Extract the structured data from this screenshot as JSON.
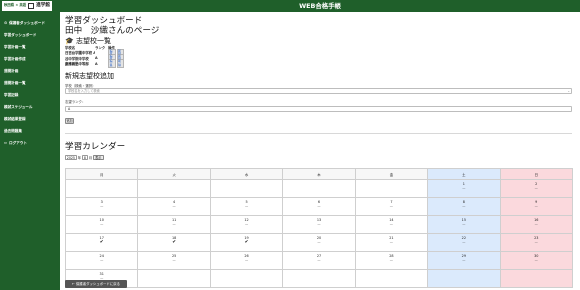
{
  "header": {
    "brand_line1": "WEB合格手帳",
    "brand_line2": "秋田県 × 英語",
    "brand_line3": "進学館",
    "title": "WEB合格手帳"
  },
  "sidebar": {
    "items": [
      {
        "icon": "⚙",
        "label": "保護者ダッシュボード"
      },
      {
        "icon": "",
        "label": "学習ダッシュボード"
      },
      {
        "icon": "",
        "label": "学習計画一覧"
      },
      {
        "icon": "",
        "label": "学習計画作成"
      },
      {
        "icon": "",
        "label": "週間計画"
      },
      {
        "icon": "",
        "label": "週間計画一覧"
      },
      {
        "icon": "",
        "label": "学習記録"
      },
      {
        "icon": "",
        "label": "模試スケジュール"
      },
      {
        "icon": "",
        "label": "模試結果登録"
      },
      {
        "icon": "",
        "label": "過去問題集"
      },
      {
        "icon": "⇦",
        "label": "ログアウト"
      }
    ]
  },
  "main": {
    "page_title": "学習ダッシュボード",
    "user_heading": "田中　沙織さんのページ",
    "school_section_icon": "🎓",
    "school_section_title": "志望校一覧",
    "school_table": {
      "headers": [
        "学校名",
        "ランク",
        "操作"
      ],
      "rows": [
        {
          "name": "日吉台学園中学校 A",
          "rank": "",
          "edit": "編集",
          "delete": "削除"
        },
        {
          "name": "谷中学院中学校",
          "rank": "A",
          "edit": "編集",
          "delete": "削除"
        },
        {
          "name": "慶應義塾中等部",
          "rank": "A",
          "edit": "編集",
          "delete": "削除"
        }
      ]
    },
    "new_school_title": "新規志望校追加",
    "school_field_label": "学校（検索・選択）",
    "school_field_placeholder": "学校名を入力して検索",
    "rank_field_label": "志望ランク：",
    "rank_field_value": "A",
    "add_button": "追加",
    "calendar_title": "学習カレンダー",
    "calendar_controls": {
      "year": "2025",
      "year_suffix": "年",
      "month": "8",
      "month_suffix": "月",
      "show_button": "表示"
    },
    "weekdays": [
      "月",
      "火",
      "水",
      "木",
      "金",
      "土",
      "日"
    ],
    "weeks": [
      [
        {
          "day": "",
          "mark": ""
        },
        {
          "day": "",
          "mark": ""
        },
        {
          "day": "",
          "mark": ""
        },
        {
          "day": "",
          "mark": ""
        },
        {
          "day": "",
          "mark": ""
        },
        {
          "day": "1",
          "mark": "—"
        },
        {
          "day": "2",
          "mark": "—"
        }
      ],
      [
        {
          "day": "3",
          "mark": "—"
        },
        {
          "day": "4",
          "mark": "—"
        },
        {
          "day": "5",
          "mark": "—"
        },
        {
          "day": "6",
          "mark": "—"
        },
        {
          "day": "7",
          "mark": "—"
        },
        {
          "day": "8",
          "mark": "—"
        },
        {
          "day": "9",
          "mark": "—"
        }
      ],
      [
        {
          "day": "10",
          "mark": "—"
        },
        {
          "day": "11",
          "mark": "—"
        },
        {
          "day": "12",
          "mark": "—"
        },
        {
          "day": "13",
          "mark": "—"
        },
        {
          "day": "14",
          "mark": "—"
        },
        {
          "day": "15",
          "mark": "—"
        },
        {
          "day": "16",
          "mark": "—"
        }
      ],
      [
        {
          "day": "17",
          "mark": "✔"
        },
        {
          "day": "18",
          "mark": "✔"
        },
        {
          "day": "19",
          "mark": "✔"
        },
        {
          "day": "20",
          "mark": "—"
        },
        {
          "day": "21",
          "mark": "—"
        },
        {
          "day": "22",
          "mark": "—"
        },
        {
          "day": "23",
          "mark": "—"
        }
      ],
      [
        {
          "day": "24",
          "mark": "—"
        },
        {
          "day": "25",
          "mark": "—"
        },
        {
          "day": "26",
          "mark": "—"
        },
        {
          "day": "27",
          "mark": "—"
        },
        {
          "day": "28",
          "mark": "—"
        },
        {
          "day": "29",
          "mark": "—"
        },
        {
          "day": "30",
          "mark": "—"
        }
      ],
      [
        {
          "day": "31",
          "mark": "—"
        },
        {
          "day": "",
          "mark": ""
        },
        {
          "day": "",
          "mark": ""
        },
        {
          "day": "",
          "mark": ""
        },
        {
          "day": "",
          "mark": ""
        },
        {
          "day": "",
          "mark": ""
        },
        {
          "day": "",
          "mark": ""
        }
      ]
    ],
    "back_button": "← 保護者ダッシュボードに戻る"
  },
  "colors": {
    "brand_green": "#1f5f2a",
    "saturday_bg": "#dbeafc",
    "sunday_bg": "#fbd9dd"
  }
}
